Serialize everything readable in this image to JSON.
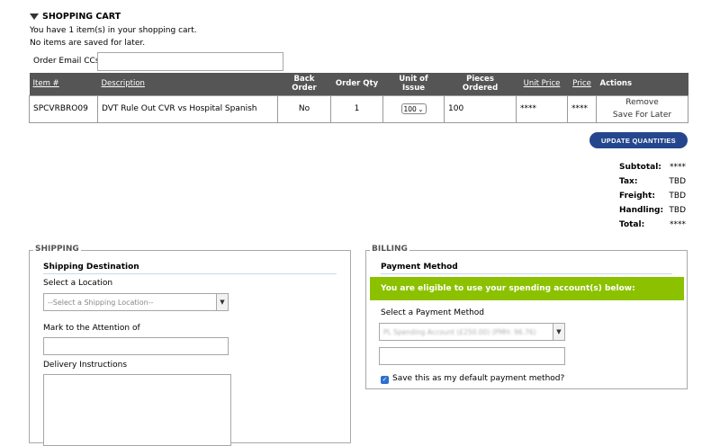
{
  "cart": {
    "title": "SHOPPING CART",
    "items_message": "You have 1 item(s) in your shopping cart.",
    "saved_message": "No items are saved for later.",
    "email_cc_label": "Order Email CCs:",
    "email_cc_value": ""
  },
  "table": {
    "headers": {
      "item": "Item #",
      "description": "Description",
      "back_order": "Back Order",
      "order_qty": "Order Qty",
      "unit_of_issue": "Unit of Issue",
      "pieces_ordered": "Pieces Ordered",
      "unit_price": "Unit Price",
      "price": "Price",
      "actions": "Actions"
    },
    "rows": [
      {
        "item": "SPCVRBRO09",
        "description": "DVT Rule Out CVR vs Hospital Spanish",
        "back_order": "No",
        "order_qty": "1",
        "unit_of_issue": "100",
        "pieces_ordered": "100",
        "unit_price": "****",
        "price": "****",
        "remove": "Remove",
        "save_for_later": "Save For Later"
      }
    ]
  },
  "update_button": "UPDATE QUANTITIES",
  "totals": {
    "subtotal_label": "Subtotal:",
    "subtotal": "****",
    "tax_label": "Tax:",
    "tax": "TBD",
    "freight_label": "Freight:",
    "freight": "TBD",
    "handling_label": "Handling:",
    "handling": "TBD",
    "total_label": "Total:",
    "total": "****"
  },
  "shipping": {
    "legend": "SHIPPING",
    "section_title": "Shipping Destination",
    "location_label": "Select a Location",
    "location_placeholder": "--Select a Shipping Location--",
    "attention_label": "Mark to the Attention of",
    "attention_value": "",
    "instructions_label": "Delivery Instructions",
    "instructions_value": ""
  },
  "billing": {
    "legend": "BILLING",
    "section_title": "Payment Method",
    "eligible_message": "You are eligible to use your spending account(s) below:",
    "method_label": "Select a Payment Method",
    "method_value": "PL Spending Account (£250.00) (PMH: 96.76)",
    "extra_value": "",
    "default_label": "Save this as my default payment method?",
    "default_checked": true
  },
  "colors": {
    "table_header_bg": "#555555",
    "button_bg": "#24468d",
    "eligible_bg": "#8cc100"
  }
}
